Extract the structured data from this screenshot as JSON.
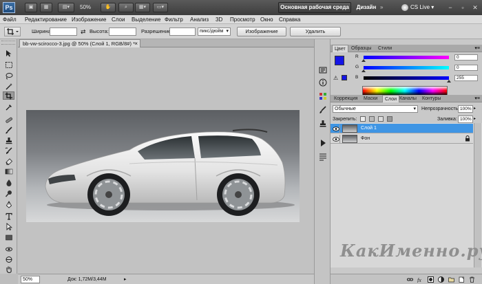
{
  "app": {
    "logo": "Ps",
    "zoom": "50%",
    "workspace_active": "Основная рабочая среда",
    "workspace_design": "Дизайн",
    "workspace_more": "»",
    "cs_live": "CS Live",
    "cs_live_dropdown": "▾",
    "window_minimize": "−",
    "window_restore": "▫",
    "window_close": "✕"
  },
  "menu": [
    "Файл",
    "Редактирование",
    "Изображение",
    "Слои",
    "Выделение",
    "Фильтр",
    "Анализ",
    "3D",
    "Просмотр",
    "Окно",
    "Справка"
  ],
  "options": {
    "width_label": "Ширина:",
    "height_label": "Высота:",
    "resolution_label": "Разрешение:",
    "unit": "пикс/дюйм",
    "unit_arrow": "▾",
    "swap_icon": "⇄",
    "image_button": "Изображение",
    "clear_button": "Удалить"
  },
  "document": {
    "tab_title": "bb-vw-scirocco-3.jpg @ 50% (Слой 1, RGB/8#) *",
    "close_glyph": "×"
  },
  "status": {
    "zoom": "50%",
    "doc_info": "Док: 1,72M/3,44M",
    "arrow": "▸"
  },
  "watermark": "КакИменно.ру",
  "color_panel": {
    "tabs": [
      "Цвет",
      "Образцы",
      "Стили"
    ],
    "active_tab": 0,
    "menu_glyph": "▾≡",
    "fg_color": "#1414e6",
    "bg_color": "#ffffff",
    "gamut_warning": "⚠",
    "channels": [
      {
        "label": "R",
        "value": "0",
        "gradient_from": "#0000ff",
        "gradient_to": "#ff00ff",
        "fraction": 0.0
      },
      {
        "label": "G",
        "value": "0",
        "gradient_from": "#0000ff",
        "gradient_to": "#00ffff",
        "fraction": 0.0
      },
      {
        "label": "B",
        "value": "255",
        "gradient_from": "#000000",
        "gradient_to": "#0000ff",
        "fraction": 1.0
      }
    ]
  },
  "layers_panel": {
    "tabs": [
      "Коррекция",
      "Маски",
      "Слои",
      "Каналы",
      "Контуры"
    ],
    "active_tab": 2,
    "menu_glyph": "▾≡",
    "blend_mode": "Обычные",
    "blend_arrow": "▾",
    "opacity_label": "Непрозрачность:",
    "opacity_value": "100%",
    "lock_label": "Закрепить:",
    "fill_label": "Заливка:",
    "fill_value": "100%",
    "layers": [
      {
        "name": "Слой 1",
        "selected": true,
        "locked": false
      },
      {
        "name": "Фон",
        "selected": false,
        "locked": true
      }
    ]
  },
  "colors": {
    "selection": "#3f95e4",
    "workspace_active_bg": "#4a4a4a"
  }
}
